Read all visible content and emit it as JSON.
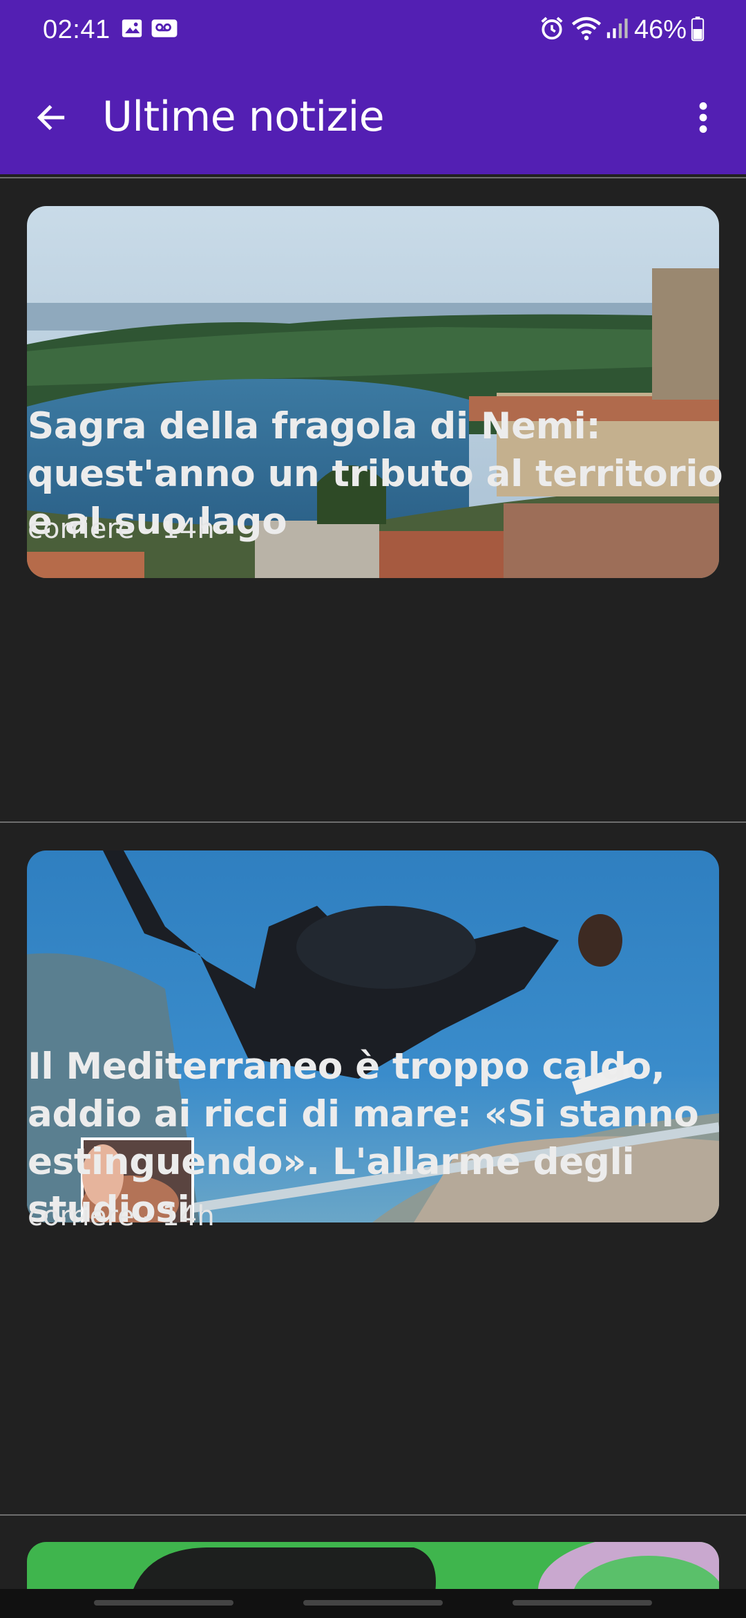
{
  "status_bar": {
    "time": "02:41",
    "battery": "46%",
    "left_icons": [
      "image-icon",
      "voicemail-icon"
    ],
    "right_icons": [
      "alarm-icon",
      "wifi-icon",
      "signal-icon",
      "battery-icon"
    ]
  },
  "app_bar": {
    "title": "Ultime notizie",
    "background": "#531fb3"
  },
  "articles": [
    {
      "title": "Sagra della fragola di Nemi: quest'anno un tributo al territorio e al suo lago",
      "meta": "corriere - 14h"
    },
    {
      "title": "Il Mediterraneo è troppo caldo, addio ai ricci di mare: «Si stanno estinguendo». L'allarme degli studiosi",
      "meta": "corriere - 14h"
    },
    {
      "title": "",
      "meta": ""
    }
  ],
  "colors": {
    "accent": "#531fb3",
    "background": "#212121",
    "text": "#ececec"
  }
}
